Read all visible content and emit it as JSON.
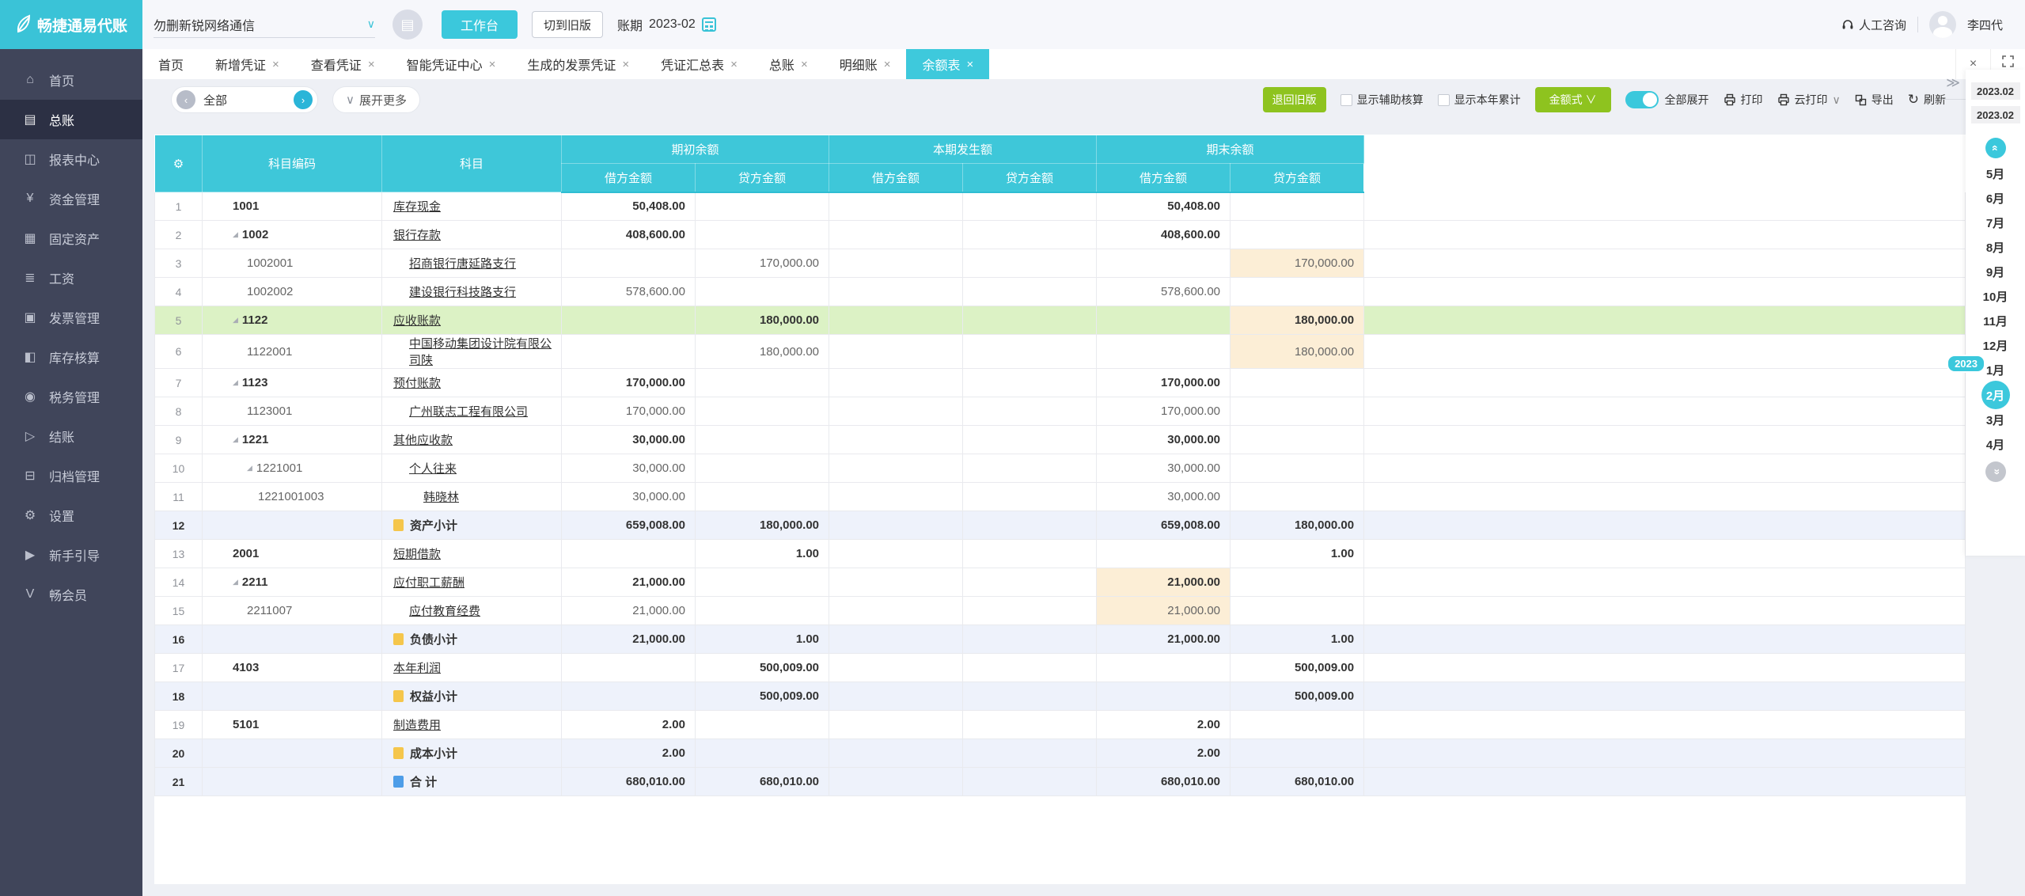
{
  "colors": {
    "accent_cyan": "#3bc8dc",
    "header_cyan": "#3ec7d9",
    "button_green": "#8ec31f",
    "sidebar_bg": "#40455a",
    "row_green": "#dcf2c5",
    "row_blue": "#eef2fb",
    "cell_orange": "#fceed6"
  },
  "topbar": {
    "logo_text": "畅捷通易代账",
    "company": "勿删新锐网络通信",
    "workbench_button": "工作台",
    "switch_old_button": "切到旧版",
    "period_label": "账期",
    "period_value": "2023-02",
    "support_label": "人工咨询",
    "user_name": "李四代"
  },
  "sidebar": {
    "items": [
      {
        "label": "首页",
        "icon": "home-icon",
        "glyph": "⌂",
        "active": false
      },
      {
        "label": "总账",
        "icon": "ledger-icon",
        "glyph": "▤",
        "active": true
      },
      {
        "label": "报表中心",
        "icon": "report-icon",
        "glyph": "◫",
        "active": false
      },
      {
        "label": "资金管理",
        "icon": "funds-icon",
        "glyph": "¥",
        "active": false
      },
      {
        "label": "固定资产",
        "icon": "assets-icon",
        "glyph": "▦",
        "active": false
      },
      {
        "label": "工资",
        "icon": "salary-icon",
        "glyph": "≣",
        "active": false
      },
      {
        "label": "发票管理",
        "icon": "invoice-icon",
        "glyph": "▣",
        "active": false
      },
      {
        "label": "库存核算",
        "icon": "inventory-icon",
        "glyph": "◧",
        "active": false
      },
      {
        "label": "税务管理",
        "icon": "tax-icon",
        "glyph": "◉",
        "active": false
      },
      {
        "label": "结账",
        "icon": "closing-icon",
        "glyph": "▷",
        "active": false
      },
      {
        "label": "归档管理",
        "icon": "archive-icon",
        "glyph": "⊟",
        "active": false
      },
      {
        "label": "设置",
        "icon": "settings-icon",
        "glyph": "⚙",
        "active": false
      },
      {
        "label": "新手引导",
        "icon": "guide-icon",
        "glyph": "▶",
        "active": false
      },
      {
        "label": "畅会员",
        "icon": "member-icon",
        "glyph": "V",
        "active": false
      }
    ]
  },
  "tabs": {
    "items": [
      {
        "label": "首页",
        "closable": false,
        "active": false
      },
      {
        "label": "新增凭证",
        "closable": true,
        "active": false
      },
      {
        "label": "查看凭证",
        "closable": true,
        "active": false
      },
      {
        "label": "智能凭证中心",
        "closable": true,
        "active": false
      },
      {
        "label": "生成的发票凭证",
        "closable": true,
        "active": false
      },
      {
        "label": "凭证汇总表",
        "closable": true,
        "active": false
      },
      {
        "label": "总账",
        "closable": true,
        "active": false
      },
      {
        "label": "明细账",
        "closable": true,
        "active": false
      },
      {
        "label": "余额表",
        "closable": true,
        "active": true
      }
    ]
  },
  "toolbar": {
    "filter_pill": "全部",
    "expand_more": "展开更多",
    "back_old_button": "退回旧版",
    "checkbox_aux": "显示辅助核算",
    "checkbox_ytd": "显示本年累计",
    "amount_style_button": "金额式",
    "expand_all_label": "全部展开",
    "print_label": "打印",
    "cloud_print_label": "云打印",
    "export_label": "导出",
    "refresh_label": "刷新"
  },
  "month_panel": {
    "period_boxes": [
      "2023.02",
      "2023.02"
    ],
    "year_badge": "2023",
    "months": [
      "5月",
      "6月",
      "7月",
      "8月",
      "9月",
      "10月",
      "11月",
      "12月",
      "1月",
      "2月",
      "3月",
      "4月"
    ],
    "active_month": "2月"
  },
  "table": {
    "col_code": "科目编码",
    "col_subject": "科目",
    "groups": [
      "期初余额",
      "本期发生额",
      "期末余额"
    ],
    "sub_cols": [
      "借方金额",
      "贷方金额"
    ],
    "rows": [
      {
        "n": 1,
        "code": "1001",
        "tri": false,
        "lvl": 1,
        "name": "库存现金",
        "bold": true,
        "hl": "",
        "icon": "",
        "v": [
          "50,408.00",
          "",
          "",
          "",
          "50,408.00",
          ""
        ],
        "orange": []
      },
      {
        "n": 2,
        "code": "1002",
        "tri": true,
        "lvl": 1,
        "name": "银行存款",
        "bold": true,
        "hl": "",
        "icon": "",
        "v": [
          "408,600.00",
          "",
          "",
          "",
          "408,600.00",
          ""
        ],
        "orange": []
      },
      {
        "n": 3,
        "code": "1002001",
        "tri": false,
        "lvl": 2,
        "name": "招商银行唐延路支行",
        "bold": false,
        "hl": "",
        "icon": "",
        "v": [
          "",
          "170,000.00",
          "",
          "",
          "",
          "170,000.00"
        ],
        "orange": [
          5
        ]
      },
      {
        "n": 4,
        "code": "1002002",
        "tri": false,
        "lvl": 2,
        "name": "建设银行科技路支行",
        "bold": false,
        "hl": "",
        "icon": "",
        "v": [
          "578,600.00",
          "",
          "",
          "",
          "578,600.00",
          ""
        ],
        "orange": []
      },
      {
        "n": 5,
        "code": "1122",
        "tri": true,
        "lvl": 1,
        "name": "应收账款",
        "bold": true,
        "hl": "green",
        "icon": "",
        "v": [
          "",
          "180,000.00",
          "",
          "",
          "",
          "180,000.00"
        ],
        "orange": [
          5
        ]
      },
      {
        "n": 6,
        "code": "1122001",
        "tri": false,
        "lvl": 2,
        "name": "中国移动集团设计院有限公司陕",
        "bold": false,
        "hl": "",
        "icon": "",
        "v": [
          "",
          "180,000.00",
          "",
          "",
          "",
          "180,000.00"
        ],
        "orange": [
          5
        ]
      },
      {
        "n": 7,
        "code": "1123",
        "tri": true,
        "lvl": 1,
        "name": "预付账款",
        "bold": true,
        "hl": "",
        "icon": "",
        "v": [
          "170,000.00",
          "",
          "",
          "",
          "170,000.00",
          ""
        ],
        "orange": []
      },
      {
        "n": 8,
        "code": "1123001",
        "tri": false,
        "lvl": 2,
        "name": "广州联志工程有限公司",
        "bold": false,
        "hl": "",
        "icon": "",
        "v": [
          "170,000.00",
          "",
          "",
          "",
          "170,000.00",
          ""
        ],
        "orange": []
      },
      {
        "n": 9,
        "code": "1221",
        "tri": true,
        "lvl": 1,
        "name": "其他应收款",
        "bold": true,
        "hl": "",
        "icon": "",
        "v": [
          "30,000.00",
          "",
          "",
          "",
          "30,000.00",
          ""
        ],
        "orange": []
      },
      {
        "n": 10,
        "code": "1221001",
        "tri": true,
        "lvl": 2,
        "name": "个人往来",
        "bold": false,
        "hl": "",
        "icon": "",
        "v": [
          "30,000.00",
          "",
          "",
          "",
          "30,000.00",
          ""
        ],
        "orange": []
      },
      {
        "n": 11,
        "code": "1221001003",
        "tri": false,
        "lvl": 3,
        "name": "韩晓林",
        "bold": false,
        "hl": "",
        "icon": "",
        "v": [
          "30,000.00",
          "",
          "",
          "",
          "30,000.00",
          ""
        ],
        "orange": []
      },
      {
        "n": 12,
        "code": "",
        "tri": false,
        "lvl": 1,
        "name": "资产小计",
        "bold": true,
        "hl": "blue",
        "icon": "yellow",
        "v": [
          "659,008.00",
          "180,000.00",
          "",
          "",
          "659,008.00",
          "180,000.00"
        ],
        "orange": []
      },
      {
        "n": 13,
        "code": "2001",
        "tri": false,
        "lvl": 1,
        "name": "短期借款",
        "bold": true,
        "hl": "",
        "icon": "",
        "v": [
          "",
          "1.00",
          "",
          "",
          "",
          "1.00"
        ],
        "orange": []
      },
      {
        "n": 14,
        "code": "2211",
        "tri": true,
        "lvl": 1,
        "name": "应付职工薪酬",
        "bold": true,
        "hl": "",
        "icon": "",
        "v": [
          "21,000.00",
          "",
          "",
          "",
          "21,000.00",
          ""
        ],
        "orange": [
          4
        ]
      },
      {
        "n": 15,
        "code": "2211007",
        "tri": false,
        "lvl": 2,
        "name": "应付教育经费",
        "bold": false,
        "hl": "",
        "icon": "",
        "v": [
          "21,000.00",
          "",
          "",
          "",
          "21,000.00",
          ""
        ],
        "orange": [
          4
        ]
      },
      {
        "n": 16,
        "code": "",
        "tri": false,
        "lvl": 1,
        "name": "负债小计",
        "bold": true,
        "hl": "blue",
        "icon": "yellow",
        "v": [
          "21,000.00",
          "1.00",
          "",
          "",
          "21,000.00",
          "1.00"
        ],
        "orange": []
      },
      {
        "n": 17,
        "code": "4103",
        "tri": false,
        "lvl": 1,
        "name": "本年利润",
        "bold": true,
        "hl": "",
        "icon": "",
        "v": [
          "",
          "500,009.00",
          "",
          "",
          "",
          "500,009.00"
        ],
        "orange": []
      },
      {
        "n": 18,
        "code": "",
        "tri": false,
        "lvl": 1,
        "name": "权益小计",
        "bold": true,
        "hl": "blue",
        "icon": "yellow",
        "v": [
          "",
          "500,009.00",
          "",
          "",
          "",
          "500,009.00"
        ],
        "orange": []
      },
      {
        "n": 19,
        "code": "5101",
        "tri": false,
        "lvl": 1,
        "name": "制造费用",
        "bold": true,
        "hl": "",
        "icon": "",
        "v": [
          "2.00",
          "",
          "",
          "",
          "2.00",
          ""
        ],
        "orange": []
      },
      {
        "n": 20,
        "code": "",
        "tri": false,
        "lvl": 1,
        "name": "成本小计",
        "bold": true,
        "hl": "blue",
        "icon": "yellow",
        "v": [
          "2.00",
          "",
          "",
          "",
          "2.00",
          ""
        ],
        "orange": []
      },
      {
        "n": 21,
        "code": "",
        "tri": false,
        "lvl": 1,
        "name": "合 计",
        "bold": true,
        "hl": "blue",
        "icon": "blue",
        "v": [
          "680,010.00",
          "680,010.00",
          "",
          "",
          "680,010.00",
          "680,010.00"
        ],
        "orange": []
      }
    ]
  }
}
